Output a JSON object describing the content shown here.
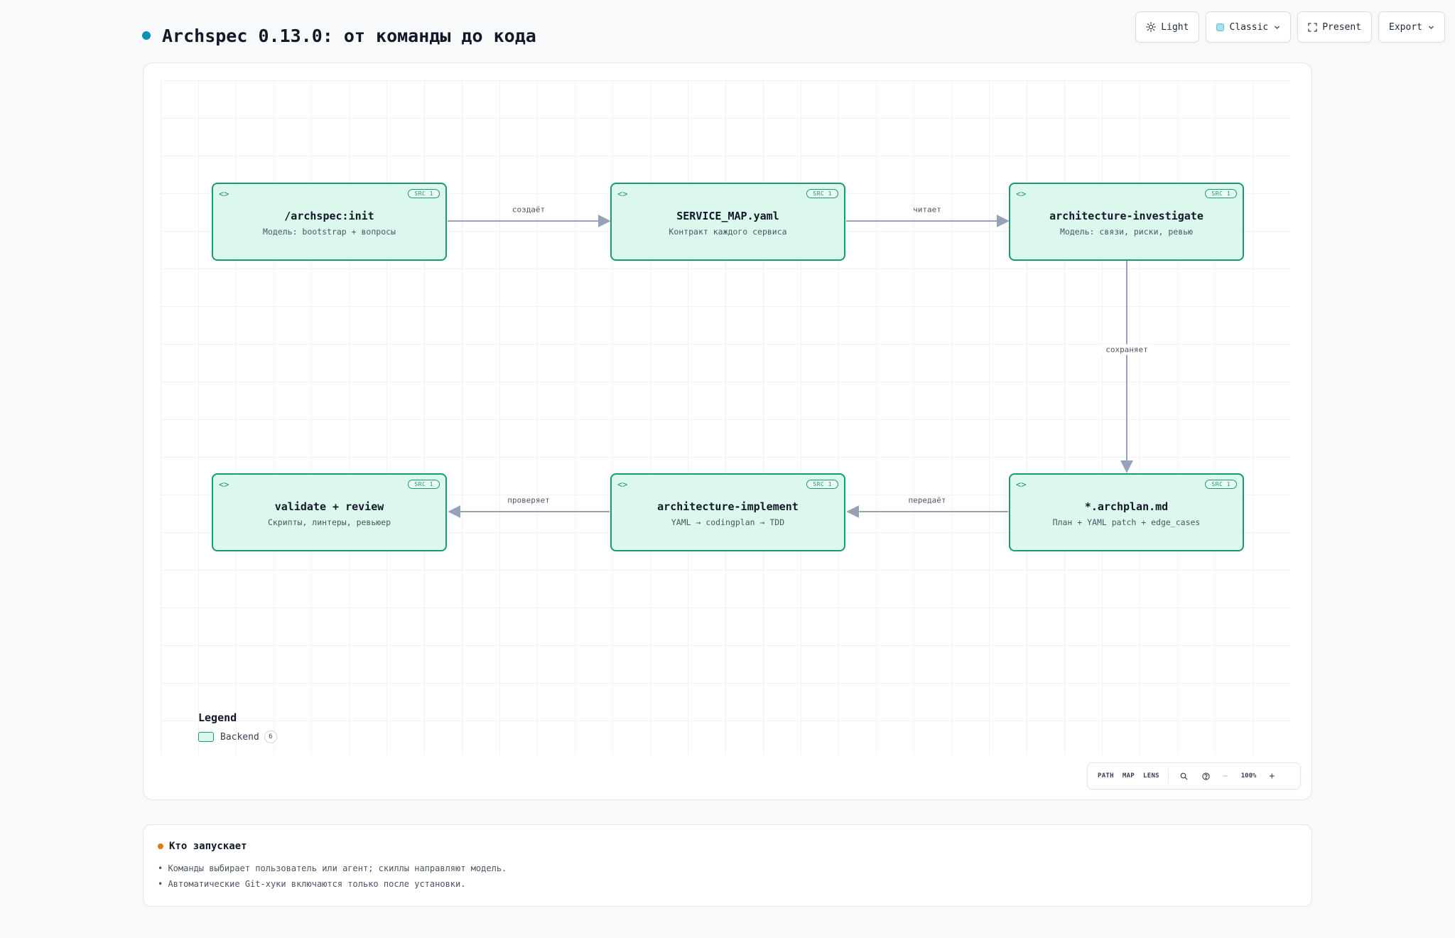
{
  "header": {
    "title": "Archspec 0.13.0: от команды до кода",
    "accent_color": "#0e8fb4"
  },
  "toolbar": {
    "theme_label": "Light",
    "theme_icon": "sun-icon",
    "style_label": "Classic",
    "present_label": "Present",
    "present_icon": "fullscreen-icon",
    "export_label": "Export"
  },
  "diagram": {
    "nodes": [
      {
        "title": "/archspec:init",
        "subtitle": "Модель: bootstrap + вопросы",
        "badge": "SRC 1",
        "icon": "code-icon"
      },
      {
        "title": "SERVICE_MAP.yaml",
        "subtitle": "Контракт каждого сервиса",
        "badge": "SRC 1",
        "icon": "code-icon"
      },
      {
        "title": "architecture-investigate",
        "subtitle": "Модель: связи, риски, ревью",
        "badge": "SRC 1",
        "icon": "code-icon"
      },
      {
        "title": "validate + review",
        "subtitle": "Скрипты, линтеры, ревьюер",
        "badge": "SRC 1",
        "icon": "code-icon"
      },
      {
        "title": "architecture-implement",
        "subtitle": "YAML → codingplan → TDD",
        "badge": "SRC 1",
        "icon": "code-icon"
      },
      {
        "title": "*.archplan.md",
        "subtitle": "План + YAML patch + edge_cases",
        "badge": "SRC 1",
        "icon": "code-icon"
      }
    ],
    "edges": [
      {
        "from": "/archspec:init",
        "to": "SERVICE_MAP.yaml",
        "label": "создаёт"
      },
      {
        "from": "SERVICE_MAP.yaml",
        "to": "architecture-investigate",
        "label": "читает"
      },
      {
        "from": "architecture-investigate",
        "to": "*.archplan.md",
        "label": "сохраняет"
      },
      {
        "from": "*.archplan.md",
        "to": "architecture-implement",
        "label": "передаёт"
      },
      {
        "from": "architecture-implement",
        "to": "validate + review",
        "label": "проверяет"
      }
    ],
    "node_color": "#dcf7ed",
    "node_border_color": "#1a9a6c",
    "edge_color": "#94a3b8"
  },
  "legend": {
    "title": "Legend",
    "items": [
      {
        "label": "Backend",
        "count": "6"
      }
    ]
  },
  "controls": {
    "path": "PATH",
    "map": "MAP",
    "lens": "LENS",
    "zoom": "100%",
    "minus": "−",
    "plus": "+"
  },
  "info": {
    "title": "Кто запускает",
    "dot_color": "#e07b12",
    "items": [
      "• Команды выбирает пользователь или агент; скиллы направляют модель.",
      "• Автоматические Git-хуки включаются только после установки."
    ]
  }
}
